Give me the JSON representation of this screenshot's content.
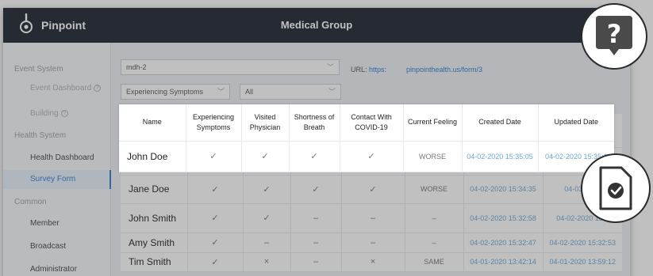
{
  "header": {
    "brand": "Pinpoint",
    "org": "Medical Group"
  },
  "sidebar": {
    "items": [
      {
        "kind": "section",
        "label": "Event System"
      },
      {
        "kind": "sub",
        "label": "Event Dashboard"
      },
      {
        "kind": "sub",
        "label": "Building"
      },
      {
        "kind": "section",
        "label": "Health System"
      },
      {
        "kind": "link",
        "label": "Health Dashboard"
      },
      {
        "kind": "active",
        "label": "Survey Form"
      },
      {
        "kind": "section",
        "label": "Common"
      },
      {
        "kind": "link",
        "label": "Member"
      },
      {
        "kind": "link",
        "label": "Broadcast"
      },
      {
        "kind": "link",
        "label": "Administrator"
      }
    ]
  },
  "filters": {
    "form_select": "mdh-2",
    "url_label": "URL:",
    "url_scheme": "https:",
    "url_host": "pinpointhealth.us/form/3",
    "symptom_select": "Experiencing Symptoms",
    "status_select": "All"
  },
  "table": {
    "columns": [
      "Name",
      "Experiencing Symptoms",
      "Visited Physician",
      "Shortness of Breath",
      "Contact With COVID-19",
      "Current Feeling",
      "Created Date",
      "Updated Date"
    ],
    "rows": [
      {
        "name": "John Doe",
        "symptoms": "✓",
        "physician": "✓",
        "breath": "✓",
        "contact": "✓",
        "feeling": "WORSE",
        "created": "04-02-2020 15:35:05",
        "updated": "04-02-2020 15:35:1"
      },
      {
        "name": "Jane Doe",
        "symptoms": "✓",
        "physician": "✓",
        "breath": "✓",
        "contact": "✓",
        "feeling": "WORSE",
        "created": "04-02-2020 15:34:35",
        "updated": "04-03-2020"
      },
      {
        "name": "John Smith",
        "symptoms": "✓",
        "physician": "✓",
        "breath": "–",
        "contact": "–",
        "feeling": "–",
        "created": "04-02-2020 15:32:58",
        "updated": "04-02-2020 15:3"
      },
      {
        "name": "Amy Smith",
        "symptoms": "✓",
        "physician": "–",
        "breath": "–",
        "contact": "–",
        "feeling": "–",
        "created": "04-02-2020 15:32:47",
        "updated": "04-02-2020 15:32:53"
      },
      {
        "name": "Tim Smith",
        "symptoms": "✓",
        "physician": "×",
        "breath": "–",
        "contact": "×",
        "feeling": "SAME",
        "created": "04-01-2020 13:42:14",
        "updated": "04-01-2020 13:59:12"
      }
    ]
  },
  "overlay_icons": [
    "help-bubble-icon",
    "document-check-icon"
  ],
  "colors": {
    "topbar": "#1b2230",
    "accent": "#2f7fd1"
  }
}
